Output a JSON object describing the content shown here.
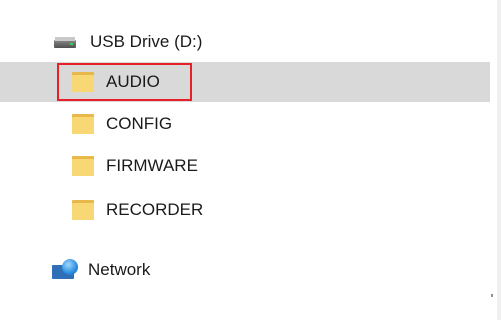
{
  "tree": {
    "drive": {
      "label": "USB Drive (D:)",
      "icon": "usb-drive-icon"
    },
    "folders": [
      {
        "label": "AUDIO",
        "icon": "folder-icon",
        "selected": true
      },
      {
        "label": "CONFIG",
        "icon": "folder-icon",
        "selected": false
      },
      {
        "label": "FIRMWARE",
        "icon": "folder-icon",
        "selected": false
      },
      {
        "label": "RECORDER",
        "icon": "folder-icon",
        "selected": false
      }
    ],
    "network": {
      "label": "Network",
      "icon": "network-icon"
    }
  },
  "colors": {
    "selection_bg": "#d9d9d9",
    "highlight_border": "#e8202a",
    "folder": "#f8d775"
  }
}
